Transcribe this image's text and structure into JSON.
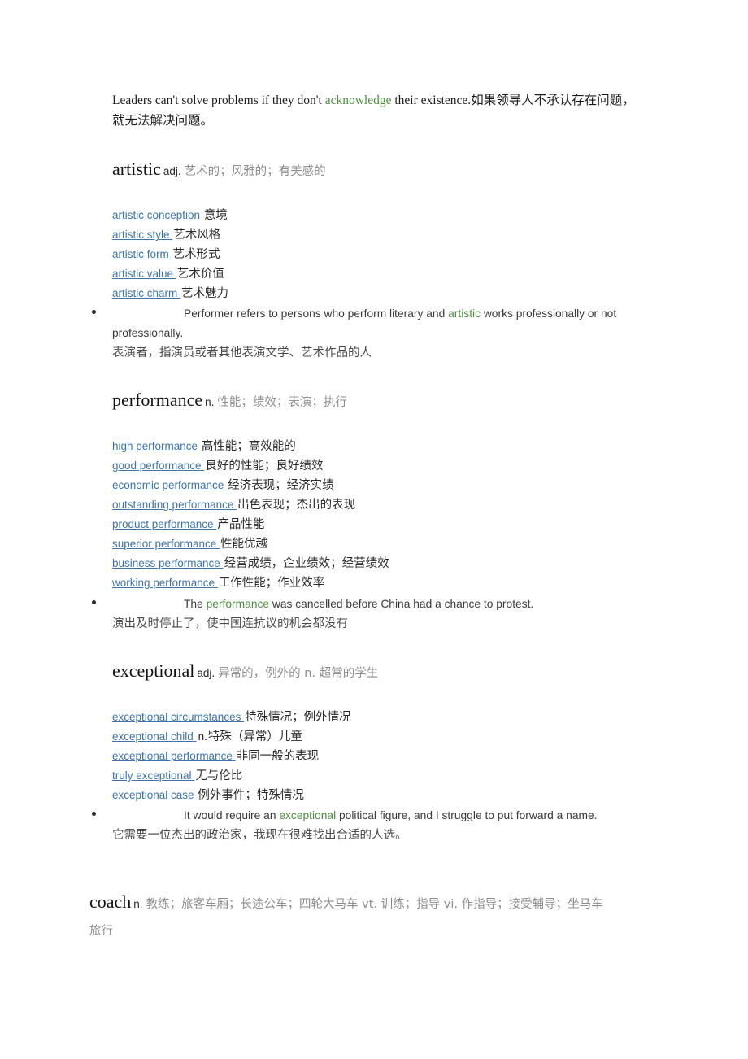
{
  "colors": {
    "highlight_green": "#4e8c42",
    "link_blue": "#3f73ad",
    "gloss_gray": "#8d8d8d",
    "body_text": "#2b2b2b"
  },
  "intro": {
    "english_before": "Leaders can't solve problems if they don't ",
    "highlight": "acknowledge",
    "english_after": " their existence.",
    "chinese": "如果领导人不承认存在问题，就无法解决问题。"
  },
  "entries": [
    {
      "headword": "artistic",
      "pos": "adj.",
      "gloss": "艺术的；风雅的；有美感的",
      "collocations": [
        {
          "term": "artistic conception ",
          "pos": "",
          "zh": "意境"
        },
        {
          "term": "artistic style ",
          "pos": "",
          "zh": "艺术风格"
        },
        {
          "term": "artistic form ",
          "pos": "",
          "zh": "艺术形式"
        },
        {
          "term": "artistic value ",
          "pos": "",
          "zh": "艺术价值"
        },
        {
          "term": "artistic charm ",
          "pos": "",
          "zh": "艺术魅力"
        }
      ],
      "example": {
        "english_before": "Performer refers to persons who perform literary and ",
        "highlight": "artistic",
        "english_after": " works professionally or not professionally.",
        "chinese": "表演者，指演员或者其他表演文学、艺术作品的人"
      }
    },
    {
      "headword": "performance",
      "pos": "n.",
      "gloss": "性能；绩效；表演；执行",
      "collocations": [
        {
          "term": "high performance ",
          "pos": "",
          "zh": "高性能；高效能的"
        },
        {
          "term": "good performance ",
          "pos": "",
          "zh": "良好的性能；良好绩效"
        },
        {
          "term": "economic performance ",
          "pos": "",
          "zh": "经济表现；经济实绩"
        },
        {
          "term": "outstanding performance ",
          "pos": "",
          "zh": "出色表现；杰出的表现"
        },
        {
          "term": "product performance ",
          "pos": "",
          "zh": "产品性能"
        },
        {
          "term": "superior performance ",
          "pos": "",
          "zh": "性能优越"
        },
        {
          "term": "business performance ",
          "pos": "",
          "zh": "经营成绩，企业绩效；经营绩效"
        },
        {
          "term": "working performance ",
          "pos": "",
          "zh": "工作性能；作业效率"
        }
      ],
      "example": {
        "english_before": "The ",
        "highlight": "performance",
        "english_after": " was cancelled before China had a chance to protest.",
        "chinese": "演出及时停止了，使中国连抗议的机会都没有"
      }
    },
    {
      "headword": "exceptional",
      "pos": "adj.",
      "gloss": "异常的，例外的  n. 超常的学生",
      "collocations": [
        {
          "term": "exceptional circumstances ",
          "pos": "",
          "zh": "特殊情况；例外情况"
        },
        {
          "term": "exceptional child ",
          "pos": "n.",
          "zh": "特殊（异常）儿童"
        },
        {
          "term": "exceptional performance ",
          "pos": "",
          "zh": "非同一般的表现"
        },
        {
          "term": "truly exceptional ",
          "pos": "",
          "zh": "无与伦比"
        },
        {
          "term": "exceptional case ",
          "pos": "",
          "zh": "例外事件；特殊情况"
        }
      ],
      "example": {
        "english_before": "It would require an ",
        "highlight": "exceptional",
        "english_after": " political figure, and I struggle to put forward a name.",
        "chinese": "它需要一位杰出的政治家，我现在很难找出合适的人选。"
      }
    },
    {
      "headword": "coach",
      "pos": "n.",
      "gloss": "教练；旅客车厢；长途公车；四轮大马车  vt. 训练；指导  vi. 作指导；接受辅导；坐马车",
      "gloss_line2": "旅行",
      "collocations": [],
      "example": null
    }
  ]
}
